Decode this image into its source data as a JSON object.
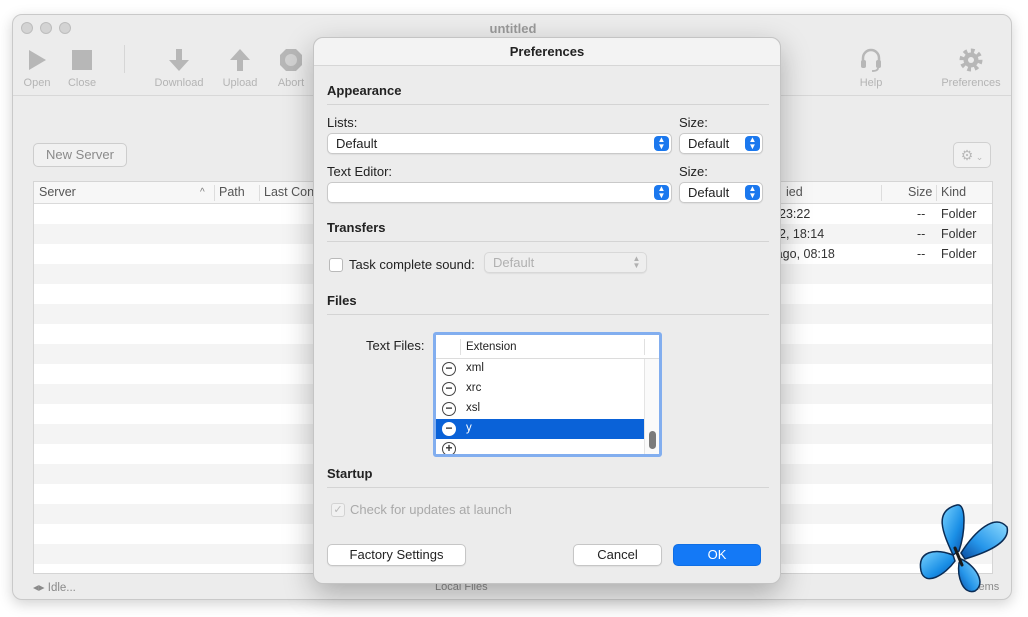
{
  "window": {
    "title": "untitled"
  },
  "toolbar": {
    "open": "Open",
    "close": "Close",
    "download": "Download",
    "upload": "Upload",
    "abort": "Abort",
    "help": "Help",
    "preferences": "Preferences"
  },
  "actions": {
    "new_server": "New Server"
  },
  "server_table": {
    "columns": [
      "Server",
      "Path",
      "Last Con"
    ]
  },
  "remote_table": {
    "columns": [
      "ied",
      "Size",
      "Kind"
    ],
    "rows": [
      {
        "modified": "23:22",
        "size": "--",
        "kind": "Folder"
      },
      {
        "modified": "2, 18:14",
        "size": "--",
        "kind": "Folder"
      },
      {
        "modified": "s ago, 08:18",
        "size": "--",
        "kind": "Folder"
      }
    ]
  },
  "status": {
    "left": "Idle...",
    "middle": "Local Files",
    "right": "items"
  },
  "preferences": {
    "title": "Preferences",
    "appearance": {
      "title": "Appearance",
      "lists_label": "Lists:",
      "lists_value": "Default",
      "size_label": "Size:",
      "lists_size_value": "Default",
      "text_editor_label": "Text Editor:",
      "text_editor_value": "",
      "text_editor_size_value": "Default"
    },
    "transfers": {
      "title": "Transfers",
      "task_complete_label": "Task complete sound:",
      "task_complete_checked": false,
      "sound_value": "Default"
    },
    "files": {
      "title": "Files",
      "text_files_label": "Text Files:",
      "extension_header": "Extension",
      "extensions": [
        "xml",
        "xrc",
        "xsl",
        "y"
      ],
      "selected": "y"
    },
    "startup": {
      "title": "Startup",
      "check_updates_label": "Check for updates at launch",
      "check_updates_checked": true
    },
    "buttons": {
      "factory_settings": "Factory Settings",
      "cancel": "Cancel",
      "ok": "OK"
    }
  },
  "colors": {
    "accent": "#1479f6",
    "selection": "#0a62d8",
    "focus_ring": "#82aeef"
  }
}
